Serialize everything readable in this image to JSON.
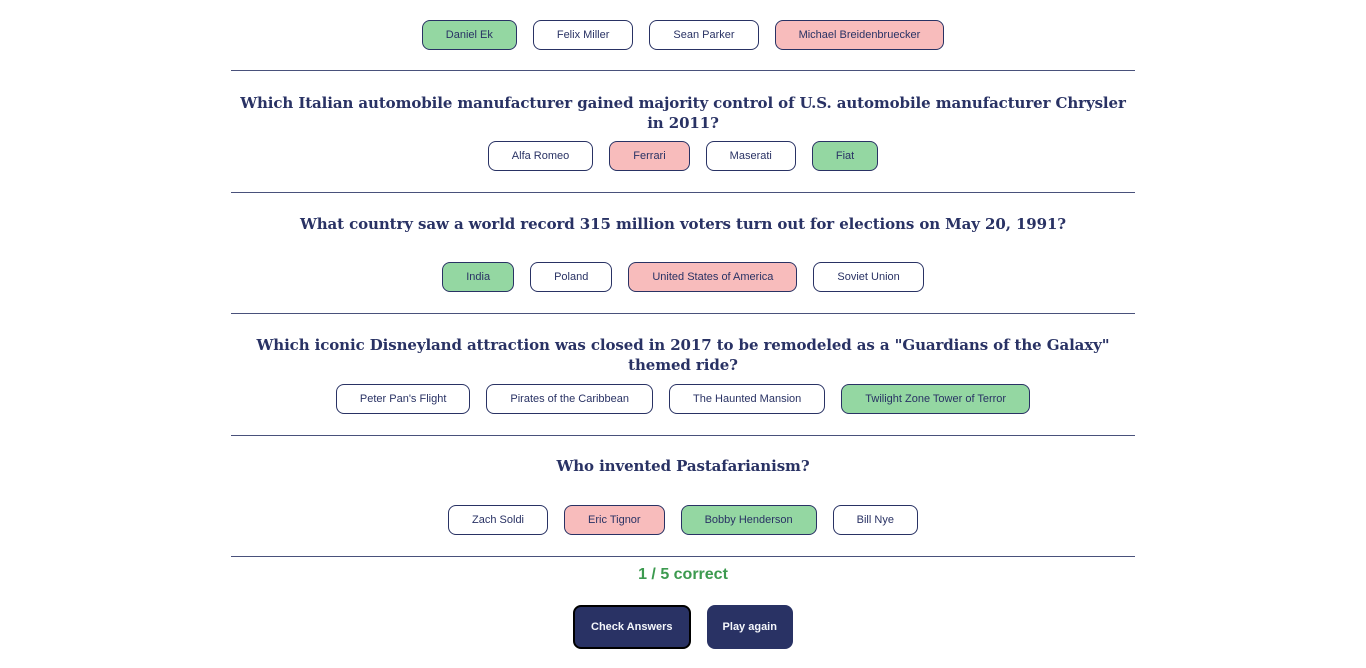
{
  "questions": [
    {
      "question": "",
      "options": [
        {
          "label": "Daniel Ek",
          "state": "correct"
        },
        {
          "label": "Felix Miller",
          "state": "none"
        },
        {
          "label": "Sean Parker",
          "state": "none"
        },
        {
          "label": "Michael Breidenbruecker",
          "state": "wrong"
        }
      ]
    },
    {
      "question": "Which Italian automobile manufacturer gained majority control of U.S. automobile manufacturer Chrysler in 2011?",
      "options": [
        {
          "label": "Alfa Romeo",
          "state": "none"
        },
        {
          "label": "Ferrari",
          "state": "wrong"
        },
        {
          "label": "Maserati",
          "state": "none"
        },
        {
          "label": "Fiat",
          "state": "correct"
        }
      ]
    },
    {
      "question": "What country saw a world record 315 million voters turn out for elections on May 20, 1991?",
      "options": [
        {
          "label": "India",
          "state": "correct"
        },
        {
          "label": "Poland",
          "state": "none"
        },
        {
          "label": "United States of America",
          "state": "wrong"
        },
        {
          "label": "Soviet Union",
          "state": "none"
        }
      ]
    },
    {
      "question": "Which iconic Disneyland attraction was closed in 2017 to be remodeled as a \"Guardians of the Galaxy\" themed ride?",
      "options": [
        {
          "label": "Peter Pan's Flight",
          "state": "none"
        },
        {
          "label": "Pirates of the Caribbean",
          "state": "none"
        },
        {
          "label": "The Haunted Mansion",
          "state": "none"
        },
        {
          "label": "Twilight Zone Tower of Terror",
          "state": "correct"
        }
      ]
    },
    {
      "question": "Who invented Pastafarianism?",
      "options": [
        {
          "label": "Zach Soldi",
          "state": "none"
        },
        {
          "label": "Eric Tignor",
          "state": "wrong"
        },
        {
          "label": "Bobby Henderson",
          "state": "correct"
        },
        {
          "label": "Bill Nye",
          "state": "none"
        }
      ]
    }
  ],
  "score": {
    "text": "1 / 5 correct"
  },
  "actions": {
    "check_label": "Check Answers",
    "play_again_label": "Play again"
  },
  "colors": {
    "primary": "#293264",
    "correct": "#94D7A2",
    "wrong": "#F8BCBC",
    "score": "#3c9a4f"
  }
}
